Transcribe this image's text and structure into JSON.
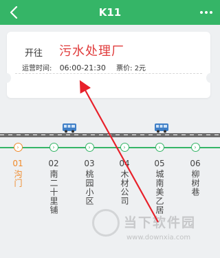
{
  "header": {
    "title": "K11",
    "back_icon": "chevron-left-icon",
    "more_icon": "more-dots-icon",
    "bg_color": "#35b567"
  },
  "ticket": {
    "direction_label": "开往",
    "destination": "污水处理厂",
    "hours_label": "运营时间:",
    "hours": "06:00-21:30",
    "price_label": "票价:",
    "price": "2元",
    "destination_color": "#e03c3c"
  },
  "route": {
    "line_color": "#35b567",
    "current_color": "#f08a2a",
    "stops": [
      {
        "num": "01",
        "name": "沟门",
        "current": true
      },
      {
        "num": "02",
        "name": "南二十里铺",
        "current": false
      },
      {
        "num": "03",
        "name": "桃园小区",
        "current": false
      },
      {
        "num": "04",
        "name": "木材公司",
        "current": false
      },
      {
        "num": "05",
        "name": "城南美乙居",
        "current": false
      },
      {
        "num": "06",
        "name": "柳树巷",
        "current": false
      }
    ],
    "bus_icon": "bus-icon"
  },
  "watermark": {
    "text": "当下软件园",
    "url": "www.downxia.com"
  }
}
